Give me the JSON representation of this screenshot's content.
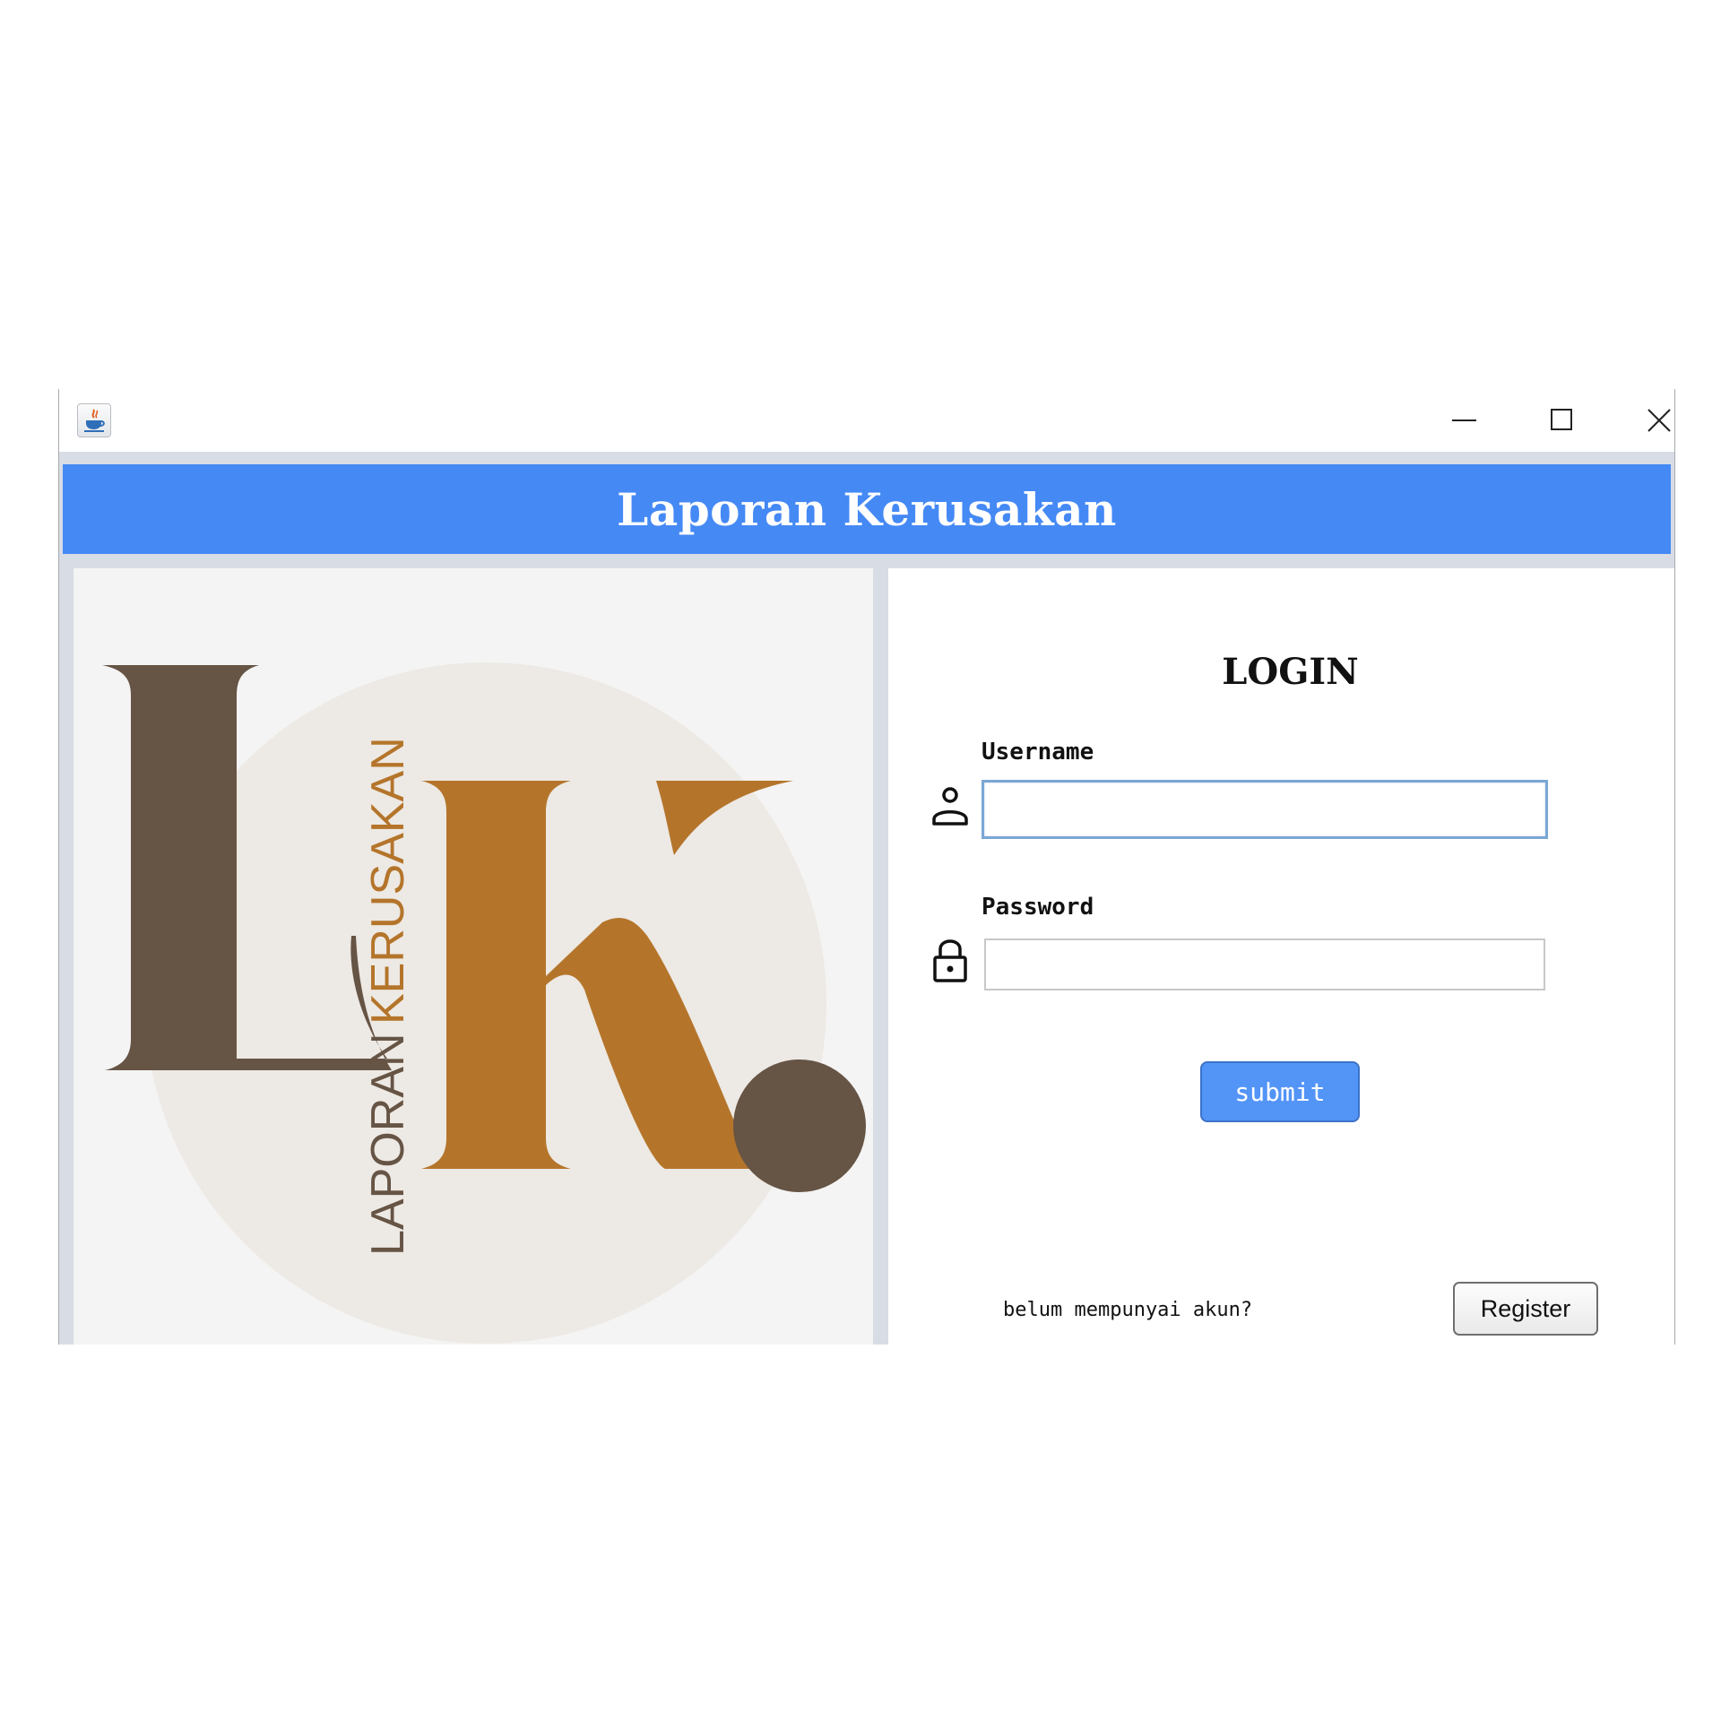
{
  "window": {
    "app_icon": "java-coffee-cup-icon",
    "controls": [
      "minimize-icon",
      "maximize-icon",
      "close-icon"
    ]
  },
  "header": {
    "title": "Laporan Kerusakan",
    "background_color": "#4589f5"
  },
  "logo": {
    "vertical_text_part1": "LAPORAN",
    "vertical_text_part2": "KERUSAKAN",
    "colors": {
      "dark_brown": "#665445",
      "orange_brown": "#b4752b",
      "beige_circle": "#ede9e4",
      "panel_bg": "#f4f4f4"
    }
  },
  "login": {
    "title": "LOGIN",
    "username_label": "Username",
    "username_value": "",
    "password_label": "Password",
    "password_value": "",
    "submit_label": "submit",
    "no_account_text": "belum mempunyai akun?",
    "register_label": "Register",
    "accent_color": "#5394f7"
  }
}
